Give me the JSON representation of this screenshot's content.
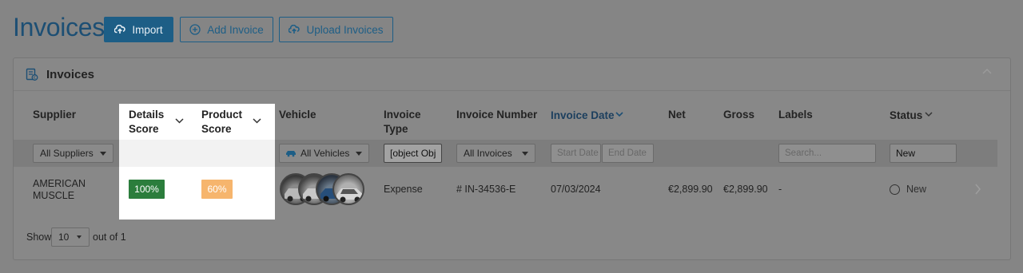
{
  "header": {
    "title": "Invoices",
    "import_label": "Import",
    "add_label": "Add Invoice",
    "upload_label": "Upload Invoices"
  },
  "card": {
    "title": "Invoices"
  },
  "columns": {
    "supplier": "Supplier",
    "details_score_1": "Details",
    "details_score_2": "Score",
    "product_score_1": "Product",
    "product_score_2": "Score",
    "vehicle": "Vehicle",
    "invoice_type_1": "Invoice",
    "invoice_type_2": "Type",
    "invoice_number": "Invoice Number",
    "invoice_date": "Invoice Date",
    "net": "Net",
    "gross": "Gross",
    "labels": "Labels",
    "status": "Status"
  },
  "filters": {
    "supplier": "All Suppliers",
    "vehicles": "All Vehicles",
    "invoice_type": "[object Obj",
    "invoices": "All Invoices",
    "start_date": "Start Date",
    "end_date": "End Date",
    "labels_placeholder": "Search...",
    "status": "New"
  },
  "row": {
    "supplier_1": "AMERICAN",
    "supplier_2": "MUSCLE",
    "details_score": "100%",
    "product_score": "60%",
    "invoice_type": "Expense",
    "invoice_number": "# IN-34536-E",
    "invoice_date": "07/03/2024",
    "net": "€2,899.90",
    "gross": "€2,899.90",
    "labels": "-",
    "status": "New"
  },
  "footer": {
    "show": "Show",
    "page_size": "10",
    "out_of": "out of 1"
  },
  "colors": {
    "accent": "#1d5e86",
    "score_good": "#2b7d3c",
    "score_mid": "#f6b56d"
  }
}
